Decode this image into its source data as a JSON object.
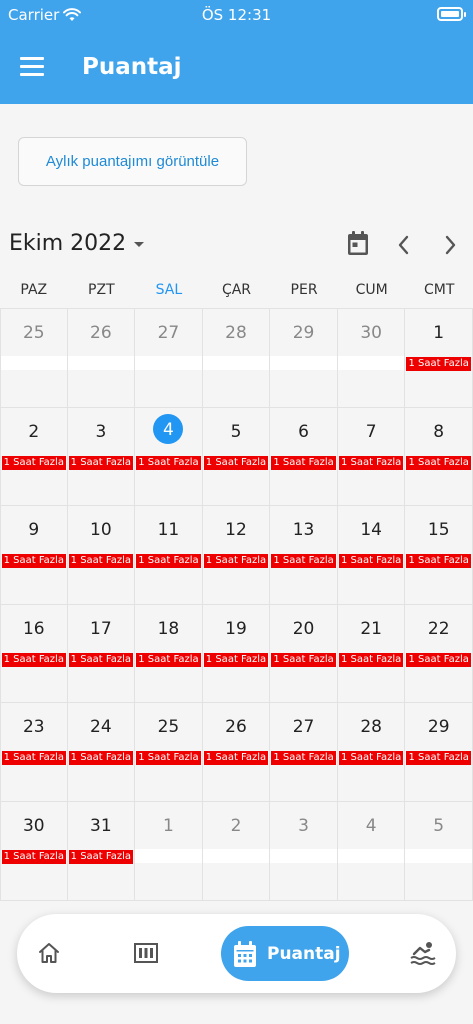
{
  "status_bar": {
    "carrier": "Carrier",
    "time": "ÖS 12:31"
  },
  "header": {
    "title": "Puantaj"
  },
  "month_button": {
    "label": "Aylık puantajımı görüntüle"
  },
  "calendar": {
    "month_label": "Ekim 2022",
    "weekdays": [
      "PAZ",
      "PZT",
      "SAL",
      "ÇAR",
      "PER",
      "CUM",
      "CMT"
    ],
    "today_weekday_index": 2,
    "badge_text": "1 Saat Fazla",
    "weeks": [
      [
        {
          "d": "25",
          "other": true,
          "badge": false
        },
        {
          "d": "26",
          "other": true,
          "badge": false
        },
        {
          "d": "27",
          "other": true,
          "badge": false
        },
        {
          "d": "28",
          "other": true,
          "badge": false
        },
        {
          "d": "29",
          "other": true,
          "badge": false
        },
        {
          "d": "30",
          "other": true,
          "badge": false
        },
        {
          "d": "1",
          "other": false,
          "badge": true
        }
      ],
      [
        {
          "d": "2",
          "other": false,
          "badge": true
        },
        {
          "d": "3",
          "other": false,
          "badge": true
        },
        {
          "d": "4",
          "other": false,
          "badge": true,
          "today": true
        },
        {
          "d": "5",
          "other": false,
          "badge": true
        },
        {
          "d": "6",
          "other": false,
          "badge": true
        },
        {
          "d": "7",
          "other": false,
          "badge": true
        },
        {
          "d": "8",
          "other": false,
          "badge": true
        }
      ],
      [
        {
          "d": "9",
          "other": false,
          "badge": true
        },
        {
          "d": "10",
          "other": false,
          "badge": true
        },
        {
          "d": "11",
          "other": false,
          "badge": true
        },
        {
          "d": "12",
          "other": false,
          "badge": true
        },
        {
          "d": "13",
          "other": false,
          "badge": true
        },
        {
          "d": "14",
          "other": false,
          "badge": true
        },
        {
          "d": "15",
          "other": false,
          "badge": true
        }
      ],
      [
        {
          "d": "16",
          "other": false,
          "badge": true
        },
        {
          "d": "17",
          "other": false,
          "badge": true
        },
        {
          "d": "18",
          "other": false,
          "badge": true
        },
        {
          "d": "19",
          "other": false,
          "badge": true
        },
        {
          "d": "20",
          "other": false,
          "badge": true
        },
        {
          "d": "21",
          "other": false,
          "badge": true
        },
        {
          "d": "22",
          "other": false,
          "badge": true
        }
      ],
      [
        {
          "d": "23",
          "other": false,
          "badge": true
        },
        {
          "d": "24",
          "other": false,
          "badge": true
        },
        {
          "d": "25",
          "other": false,
          "badge": true
        },
        {
          "d": "26",
          "other": false,
          "badge": true
        },
        {
          "d": "27",
          "other": false,
          "badge": true
        },
        {
          "d": "28",
          "other": false,
          "badge": true
        },
        {
          "d": "29",
          "other": false,
          "badge": true
        }
      ],
      [
        {
          "d": "30",
          "other": false,
          "badge": true
        },
        {
          "d": "31",
          "other": false,
          "badge": true
        },
        {
          "d": "1",
          "other": true,
          "badge": false
        },
        {
          "d": "2",
          "other": true,
          "badge": false
        },
        {
          "d": "3",
          "other": true,
          "badge": false
        },
        {
          "d": "4",
          "other": true,
          "badge": false
        },
        {
          "d": "5",
          "other": true,
          "badge": false
        }
      ]
    ]
  },
  "bottom_nav": {
    "active_label": "Puantaj",
    "items": [
      "home-icon",
      "board-icon",
      "calendar-icon",
      "swimmer-icon"
    ]
  },
  "colors": {
    "primary": "#3fa4ec",
    "today": "#2196f3",
    "badge": "#ee0000",
    "link": "#1f8ad6"
  }
}
